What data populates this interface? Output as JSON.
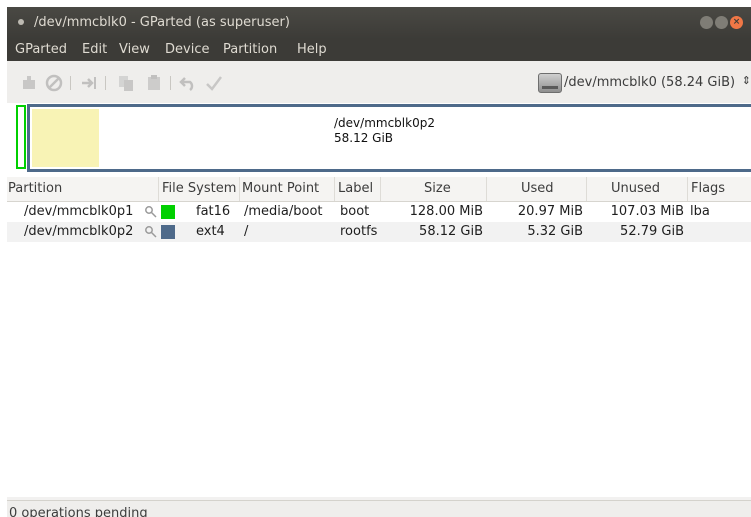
{
  "window": {
    "title": "/dev/mmcblk0 - GParted (as superuser)"
  },
  "menu": [
    "GParted",
    "Edit",
    "View",
    "Device",
    "Partition",
    "Help"
  ],
  "toolbar": {
    "device_selector": "/dev/mmcblk0  (58.24 GiB)"
  },
  "diskmap": {
    "partition_name": "/dev/mmcblk0p2",
    "partition_size": "58.12 GiB",
    "colors": {
      "fat16": "#00d000",
      "ext4": "#4e6a8a",
      "used": "#f8f3b5"
    }
  },
  "table": {
    "headers": [
      "Partition",
      "File System",
      "Mount Point",
      "Label",
      "Size",
      "Used",
      "Unused",
      "Flags"
    ],
    "rows": [
      {
        "partition": "/dev/mmcblk0p1",
        "fs": "fat16",
        "fs_color": "#00d000",
        "mount": "/media/boot",
        "label": "boot",
        "size": "128.00 MiB",
        "used": "20.97 MiB",
        "unused": "107.03 MiB",
        "flags": "lba"
      },
      {
        "partition": "/dev/mmcblk0p2",
        "fs": "ext4",
        "fs_color": "#4e6a8a",
        "mount": "/",
        "label": "rootfs",
        "size": "58.12 GiB",
        "used": "5.32 GiB",
        "unused": "52.79 GiB",
        "flags": ""
      }
    ]
  },
  "status": {
    "text": "0 operations pending"
  }
}
